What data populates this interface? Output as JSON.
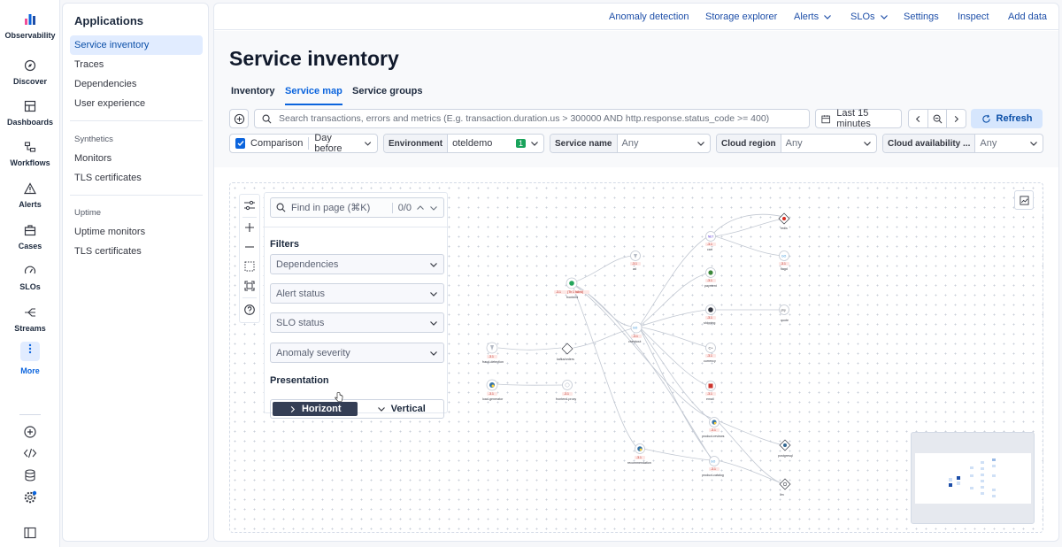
{
  "rail": {
    "items": [
      {
        "label": "Observability",
        "icon": "observability-logo-icon"
      },
      {
        "label": "Discover",
        "icon": "discover-icon"
      },
      {
        "label": "Dashboards",
        "icon": "dashboards-icon"
      },
      {
        "label": "Workflows",
        "icon": "workflows-icon"
      },
      {
        "label": "Alerts",
        "icon": "alerts-icon"
      },
      {
        "label": "Cases",
        "icon": "cases-icon"
      },
      {
        "label": "SLOs",
        "icon": "slos-icon"
      },
      {
        "label": "Streams",
        "icon": "streams-icon"
      },
      {
        "label": "More",
        "icon": "more-icon"
      }
    ]
  },
  "nav": {
    "title": "Applications",
    "items": [
      "Service inventory",
      "Traces",
      "Dependencies",
      "User experience"
    ],
    "synthetics_label": "Synthetics",
    "synthetics_items": [
      "Monitors",
      "TLS certificates"
    ],
    "uptime_label": "Uptime",
    "uptime_items": [
      "Uptime monitors",
      "TLS certificates"
    ]
  },
  "topnav": {
    "anomaly": "Anomaly detection",
    "storage": "Storage explorer",
    "alerts": "Alerts",
    "slos": "SLOs",
    "settings": "Settings",
    "inspect": "Inspect",
    "add_data": "Add data"
  },
  "page": {
    "title": "Service inventory",
    "tabs": [
      "Inventory",
      "Service map",
      "Service groups"
    ]
  },
  "search": {
    "placeholder": "Search transactions, errors and metrics (E.g. transaction.duration.us > 300000 AND http.response.status_code >= 400)",
    "time_range": "Last 15 minutes",
    "refresh": "Refresh"
  },
  "filters_bar": {
    "comparison": "Comparison",
    "comparison_value": "Day before",
    "environment_label": "Environment",
    "environment_value": "oteldemo",
    "environment_count": "1",
    "service_name_label": "Service name",
    "service_name_value": "Any",
    "cloud_region_label": "Cloud region",
    "cloud_region_value": "Any",
    "cloud_az_label": "Cloud availability ...",
    "cloud_az_value": "Any"
  },
  "map_panel": {
    "find_placeholder": "Find in page (⌘K)",
    "find_count": "0/0",
    "filters_title": "Filters",
    "dropdowns": [
      "Dependencies",
      "Alert status",
      "SLO status",
      "Anomaly severity"
    ],
    "presentation_title": "Presentation",
    "horizontal": "Horizont",
    "vertical": "Vertical"
  },
  "nodes": {
    "fraud": "fraud-detection",
    "load": "load-generator",
    "frontend": "frontend",
    "proxy": "frontend-proxy",
    "kafka": "kafka/orders",
    "ad": "ad",
    "checkout": "checkout",
    "rec": "recommendation",
    "cart": "cart",
    "payment": "payment",
    "shipping": "shipping",
    "currency": "currency",
    "email": "email",
    "product_reviews": "product-reviews",
    "product_catalog": "product-catalog",
    "redis": "redis",
    "flagd": "flagd",
    "quote": "quote",
    "postgresql": "postgresql",
    "llm": "llm",
    "badge_frontend_a": "-3.1",
    "badge_frontend_b": "(Th 1 failed)",
    "badge_neg": "-3.1"
  },
  "colors": {
    "accent": "#0b64dd",
    "active_nav_bg": "#e1ecff",
    "refresh_bg": "#d6e6fd",
    "segment_on": "#343e55"
  }
}
